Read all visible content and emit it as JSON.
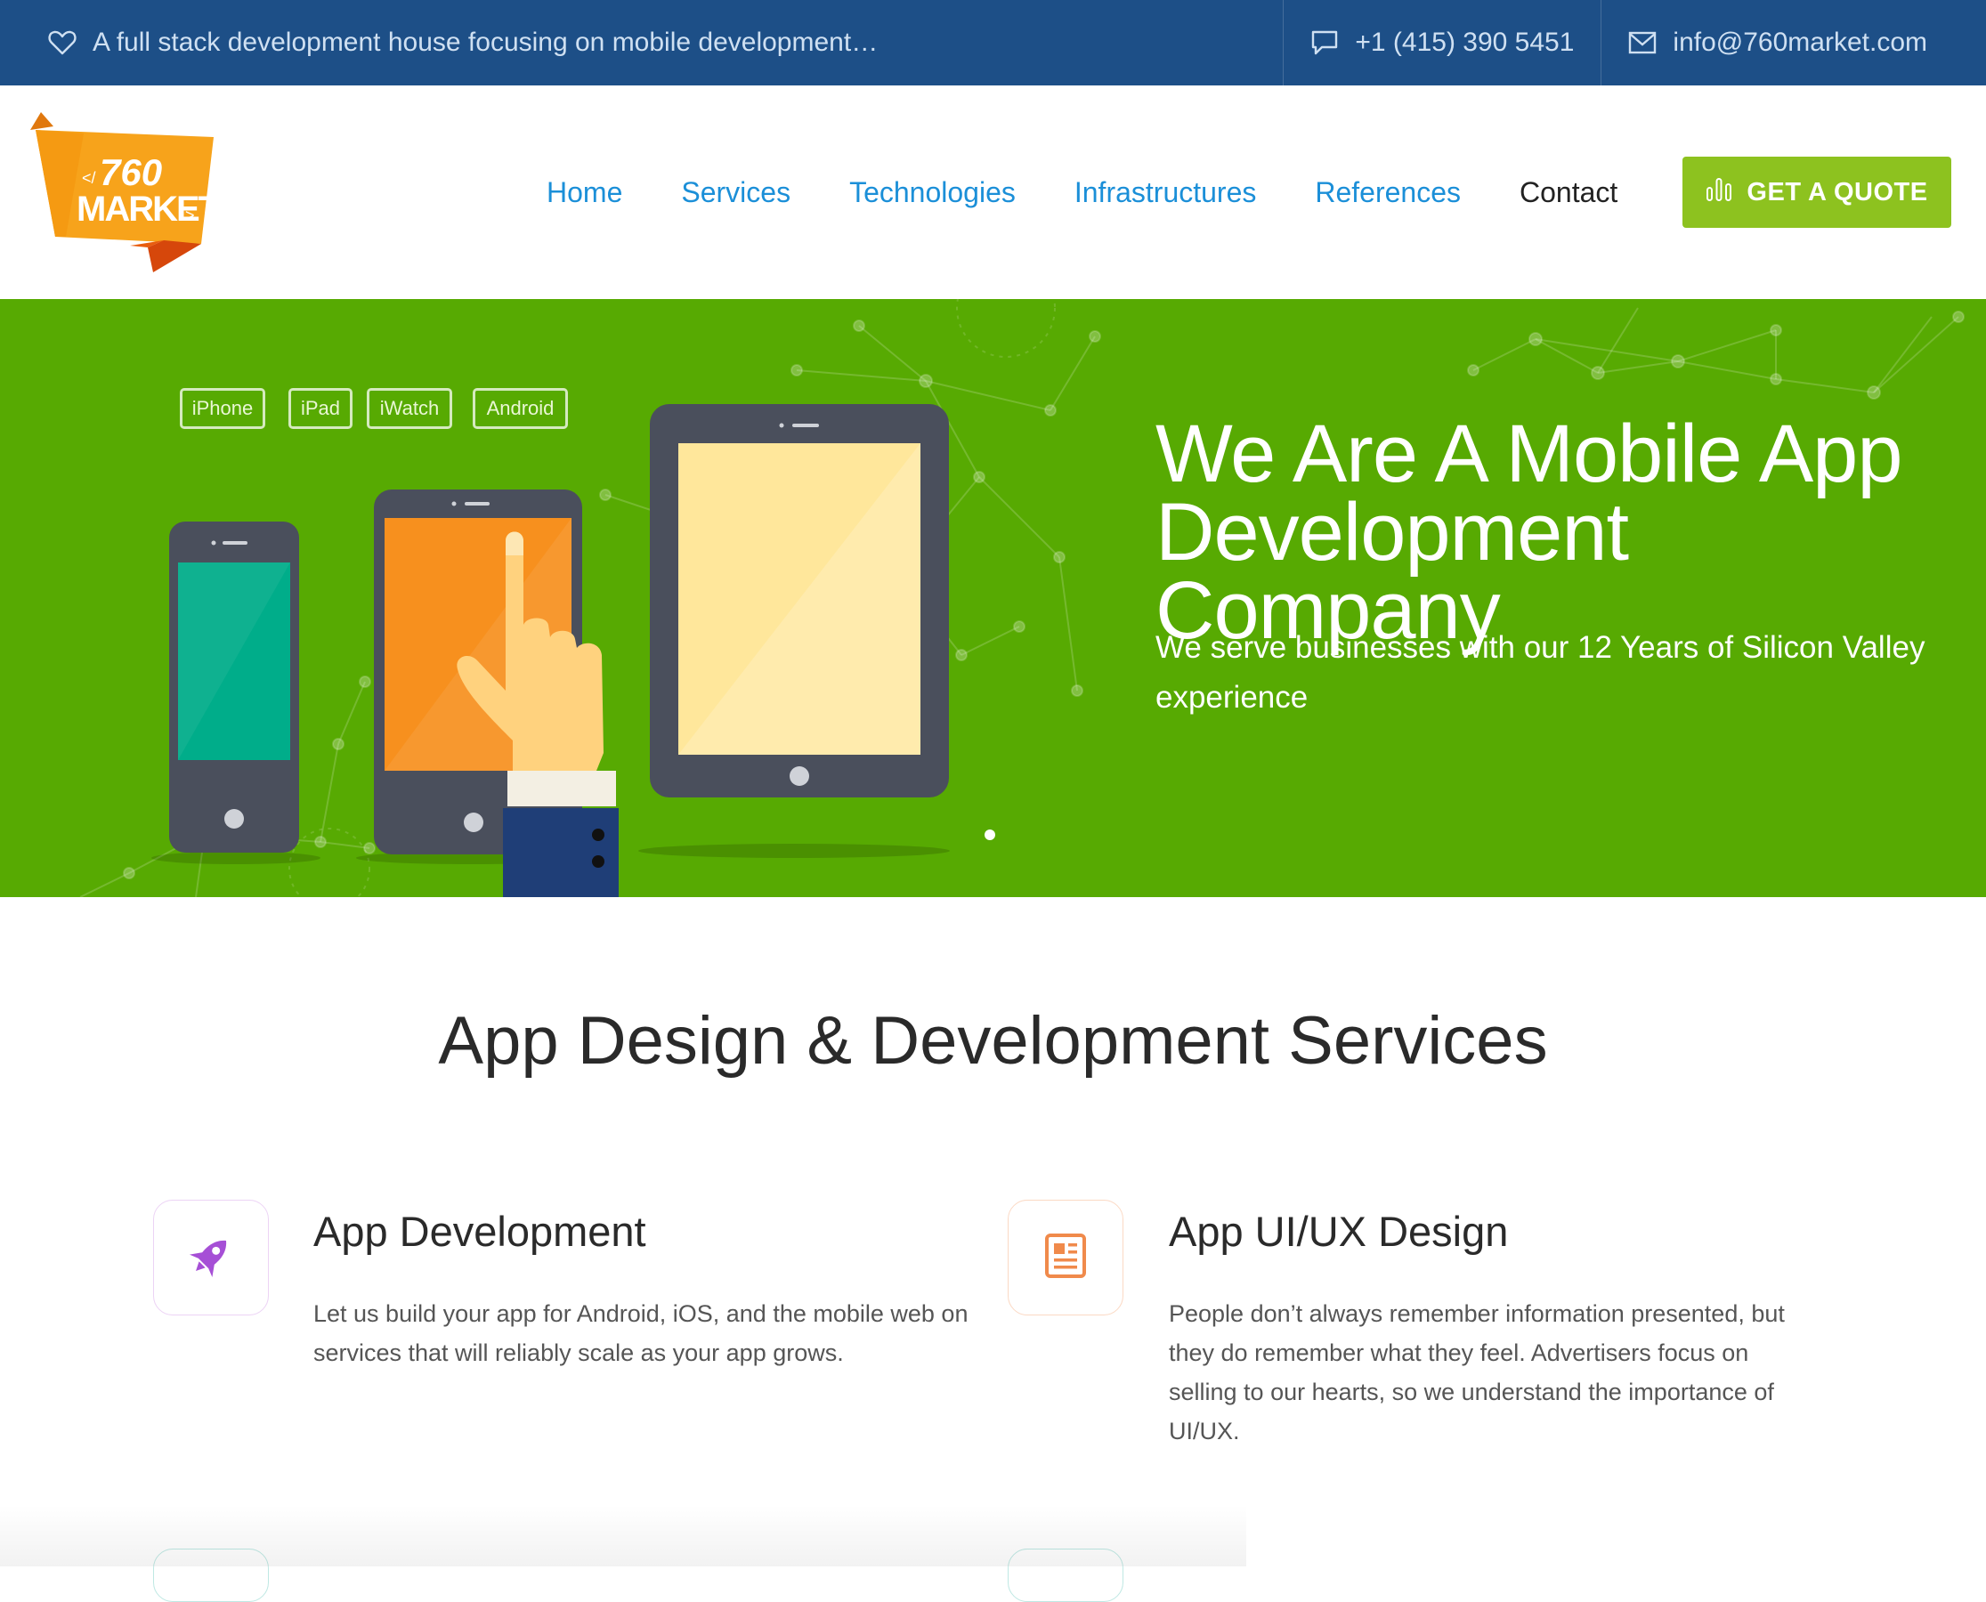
{
  "topbar": {
    "tagline": "A full stack development house focusing on mobile development…",
    "phone": "+1 (415) 390 5451",
    "email": "info@760market.com"
  },
  "logo": {
    "top": "</760",
    "bottom": "MARKET",
    "suffix": ">"
  },
  "nav": {
    "items": [
      "Home",
      "Services",
      "Technologies",
      "Infrastructures",
      "References",
      "Contact"
    ],
    "cta": "GET A QUOTE"
  },
  "hero": {
    "tags": [
      "iPhone",
      "iPad",
      "iWatch",
      "Android"
    ],
    "title_line1": "We Are A Mobile App",
    "title_line2": "Development Company",
    "subtitle": "We serve businesses with our 12 Years of Silicon Valley experience"
  },
  "services": {
    "heading": "App Design & Development Services",
    "items": [
      {
        "title": "App Development",
        "text": "Let us build your app for Android, iOS, and the mobile web on services that will reliably scale as your app grows.",
        "icon": "rocket-icon",
        "icon_color": "#a64fd6"
      },
      {
        "title": "App UI/UX Design",
        "text": "People don’t always remember information presented, but they do remember what they feel. Advertisers focus on selling to our hearts, so we understand the importance of UI/UX.",
        "icon": "newspaper-icon",
        "icon_color": "#f08a4b"
      }
    ]
  },
  "colors": {
    "topbar": "#1d4f87",
    "hero_green": "#57aa02",
    "cta_green": "#8dc21f",
    "nav_link": "#1b8fd8"
  }
}
